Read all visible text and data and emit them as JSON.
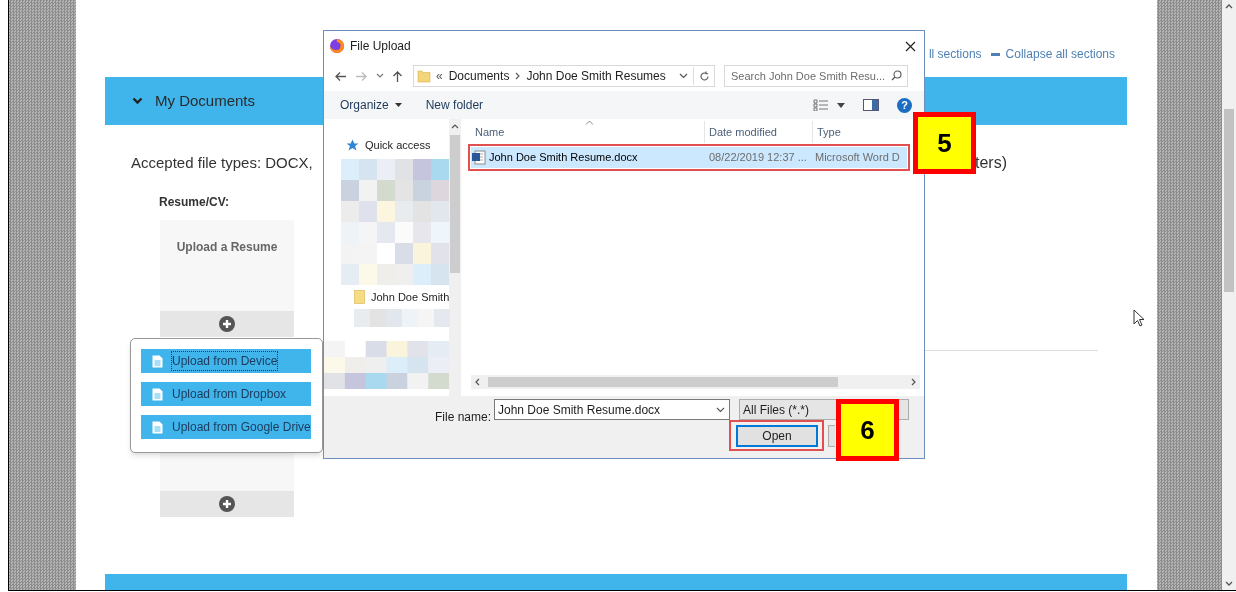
{
  "page": {
    "header_links": [
      {
        "label": "ll sections",
        "kind": "plain"
      },
      {
        "label": "Collapse all sections",
        "kind": "collapse"
      }
    ],
    "section": {
      "title": "My Documents",
      "expanded": true
    },
    "accepted_text": "Accepted file types: DOCX,",
    "accepted_text_tail": "ters)",
    "resume_label": "Resume/CV:",
    "upload_card": {
      "title": "Upload a Resume"
    }
  },
  "upload_menu": [
    {
      "label": "Upload from Device",
      "focused": true
    },
    {
      "label": "Upload from Dropbox",
      "focused": false
    },
    {
      "label": "Upload from Google Drive",
      "focused": false
    }
  ],
  "dialog": {
    "title": "File Upload",
    "breadcrumb_prefix": "«",
    "breadcrumb": [
      "Documents",
      "John Doe Smith Resumes"
    ],
    "help": "?",
    "search": {
      "placeholder": "Search John Doe Smith Resu..."
    },
    "toolbar": [
      {
        "label": "Organize",
        "dropdown": true
      },
      {
        "label": "New folder",
        "dropdown": false
      }
    ],
    "nav": [
      {
        "label": "Quick access",
        "kind": "pinned"
      },
      {
        "label": "John Doe Smith",
        "kind": "folder"
      }
    ],
    "columns": [
      "Name",
      "Date modified",
      "Type"
    ],
    "files": [
      {
        "name": "John Doe Smith Resume.docx",
        "date_modified": "08/22/2019 12:37 ...",
        "type": "Microsoft Word D",
        "selected": true
      }
    ],
    "file_name_label": "File name:",
    "file_name": "John Doe Smith Resume.docx",
    "file_type": "All Files (*.*)",
    "buttons": [
      {
        "label": "Open",
        "kind": "default"
      },
      {
        "kind": "hidden"
      }
    ]
  },
  "annotations": [
    {
      "number": "5"
    },
    {
      "number": "6"
    }
  ]
}
